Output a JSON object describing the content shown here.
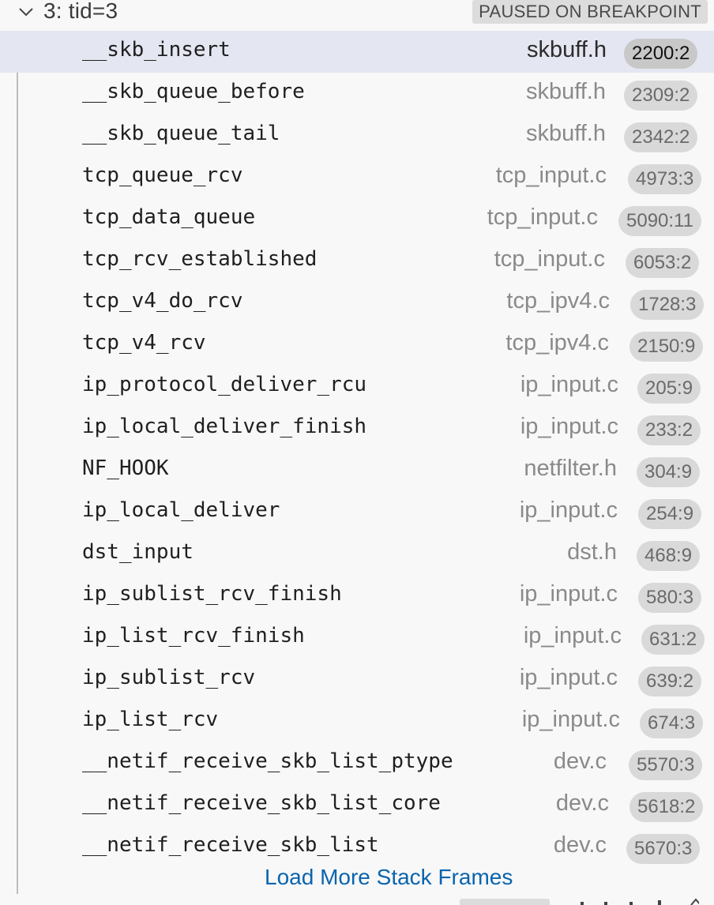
{
  "thread": {
    "title": "3: tid=3",
    "status": "PAUSED ON BREAKPOINT"
  },
  "frames": [
    {
      "name": "__skb_insert",
      "file": "skbuff.h",
      "line": "2200:2",
      "selected": true
    },
    {
      "name": "__skb_queue_before",
      "file": "skbuff.h",
      "line": "2309:2"
    },
    {
      "name": "__skb_queue_tail",
      "file": "skbuff.h",
      "line": "2342:2"
    },
    {
      "name": "tcp_queue_rcv",
      "file": "tcp_input.c",
      "line": "4973:3"
    },
    {
      "name": "tcp_data_queue",
      "file": "tcp_input.c",
      "line": "5090:11"
    },
    {
      "name": "tcp_rcv_established",
      "file": "tcp_input.c",
      "line": "6053:2"
    },
    {
      "name": "tcp_v4_do_rcv",
      "file": "tcp_ipv4.c",
      "line": "1728:3"
    },
    {
      "name": "tcp_v4_rcv",
      "file": "tcp_ipv4.c",
      "line": "2150:9"
    },
    {
      "name": "ip_protocol_deliver_rcu",
      "file": "ip_input.c",
      "line": "205:9"
    },
    {
      "name": "ip_local_deliver_finish",
      "file": "ip_input.c",
      "line": "233:2"
    },
    {
      "name": "NF_HOOK",
      "file": "netfilter.h",
      "line": "304:9"
    },
    {
      "name": "ip_local_deliver",
      "file": "ip_input.c",
      "line": "254:9"
    },
    {
      "name": "dst_input",
      "file": "dst.h",
      "line": "468:9"
    },
    {
      "name": "ip_sublist_rcv_finish",
      "file": "ip_input.c",
      "line": "580:3"
    },
    {
      "name": "ip_list_rcv_finish",
      "file": "ip_input.c",
      "line": "631:2"
    },
    {
      "name": "ip_sublist_rcv",
      "file": "ip_input.c",
      "line": "639:2"
    },
    {
      "name": "ip_list_rcv",
      "file": "ip_input.c",
      "line": "674:3"
    },
    {
      "name": "__netif_receive_skb_list_ptype",
      "file": "dev.c",
      "line": "5570:3"
    },
    {
      "name": "__netif_receive_skb_list_core",
      "file": "dev.c",
      "line": "5618:2"
    },
    {
      "name": "__netif_receive_skb_list",
      "file": "dev.c",
      "line": "5670:3"
    }
  ],
  "load_more_label": "Load More Stack Frames",
  "icons": {
    "thread_toggle": "chevron-down-icon"
  },
  "colors": {
    "selected_row": "#e4e6f1",
    "link": "#0a64ad",
    "badge": "#d9d9d9"
  }
}
